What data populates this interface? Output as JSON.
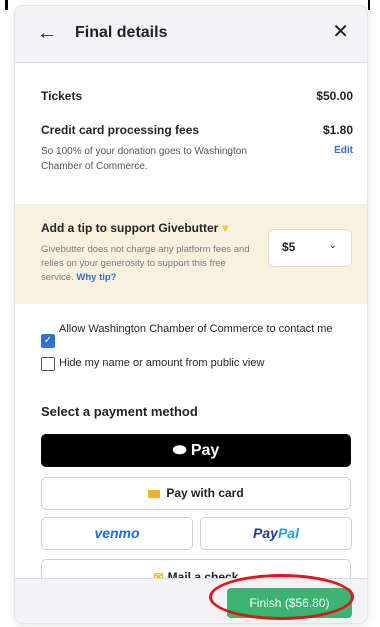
{
  "header": {
    "title": "Final details",
    "back_icon": "arrow-left-icon",
    "close_icon": "close-icon"
  },
  "summary": {
    "tickets_label": "Tickets",
    "tickets_value": "$50.00",
    "fees_label": "Credit card processing fees",
    "fees_value": "$1.80",
    "fees_note": "So 100% of your donation goes to Washington Chamber of Commerce.",
    "edit_label": "Edit"
  },
  "tip": {
    "title": "Add a tip to support Givebutter",
    "description": "Givebutter does not charge any platform fees and relies on your generosity to support this free service.",
    "why_link": "Why tip?",
    "selected": "$5",
    "heart_icon": "yellow-heart-icon"
  },
  "consent": {
    "allow_contact": {
      "label": "Allow Washington Chamber of Commerce to contact me",
      "checked": true
    },
    "hide_name": {
      "label": "Hide my name or amount from public view",
      "checked": false
    }
  },
  "payment": {
    "title": "Select a payment method",
    "apple_pay": "Pay",
    "card": "Pay with card",
    "venmo": "venmo",
    "paypal_1": "Pay",
    "paypal_2": "Pal",
    "mail_check": "Mail a check"
  },
  "footer": {
    "finish_label": "Finish ($56.80)"
  },
  "colors": {
    "accent_blue": "#2f6fd6",
    "finish_green": "#3cb371",
    "tip_bg": "#f7f1de",
    "highlight_red": "#e0141c"
  }
}
